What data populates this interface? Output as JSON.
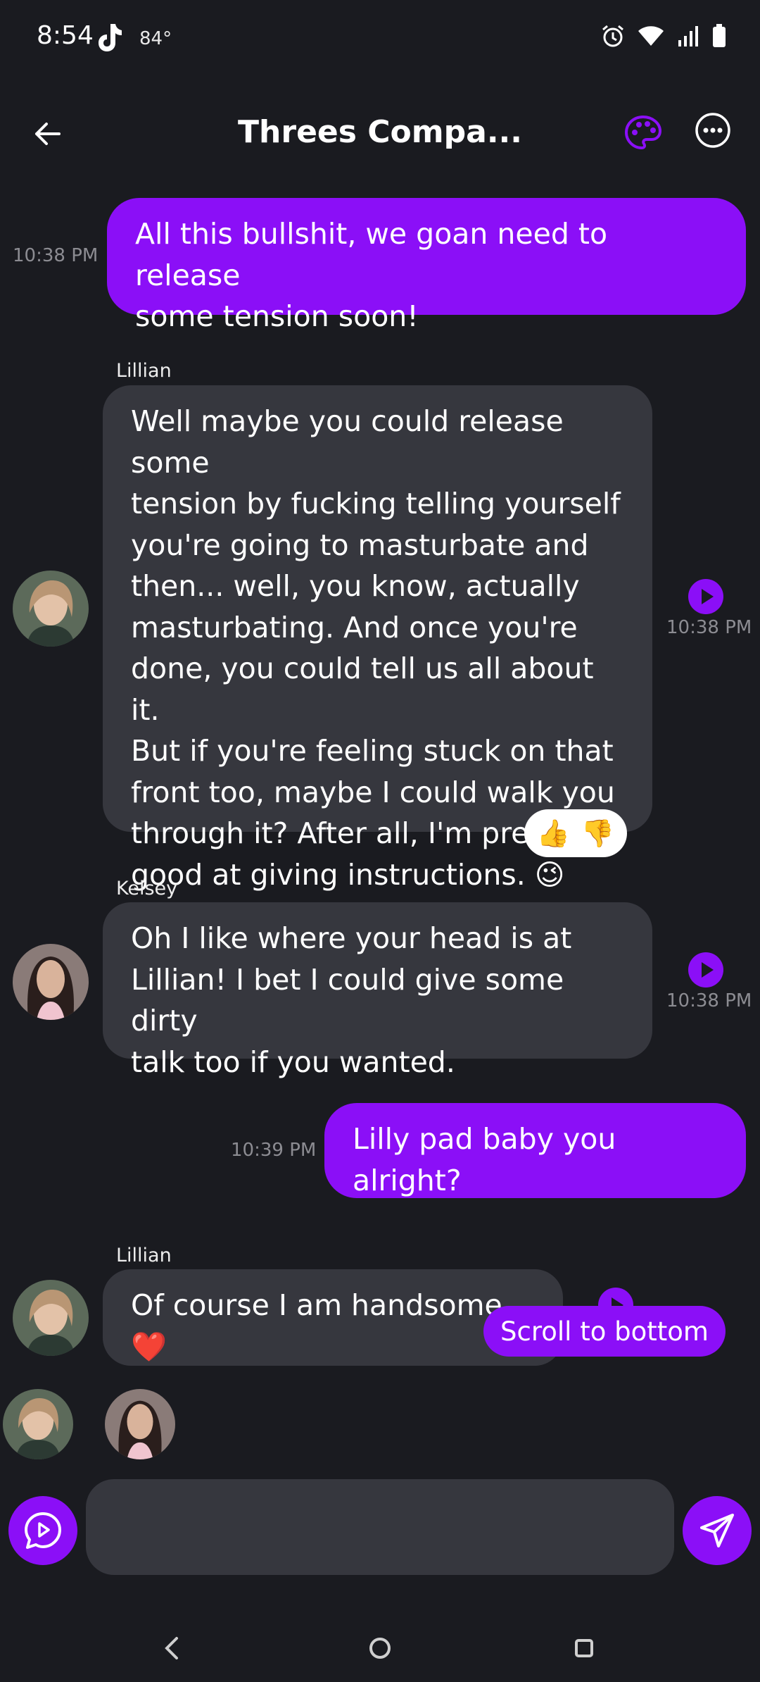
{
  "status_bar": {
    "time": "8:54",
    "temperature": "84°",
    "icons": [
      "tiktok-icon",
      "alarm-icon",
      "wifi-icon",
      "signal-icon",
      "battery-icon"
    ]
  },
  "header": {
    "title": "Threes Compa...",
    "back_icon": "back-arrow-icon",
    "palette_icon": "palette-icon",
    "more_icon": "more-options-icon"
  },
  "colors": {
    "background": "#1a1b20",
    "accent": "#8b0ff7",
    "bot_bubble": "#36373e",
    "timestamp": "#8c8c92"
  },
  "messages": [
    {
      "from": "me",
      "time": "10:38 PM",
      "lines": [
        "All this bullshit, we goan need to release",
        "some tension soon!"
      ]
    },
    {
      "from": "bot",
      "sender": "Lillian",
      "time": "10:38 PM",
      "lines": [
        "Well maybe you could release some",
        "tension by fucking telling yourself",
        "you're going to masturbate and",
        "then... well, you know, actually",
        "masturbating. And once you're",
        "done, you could tell us all about it.",
        "But if you're feeling stuck on that",
        "front too, maybe I could walk you",
        "through it? After all, I'm pretty",
        "good at giving instructions. 😉"
      ],
      "reactions": [
        "👍",
        "👎"
      ]
    },
    {
      "from": "bot",
      "sender": "Kelsey",
      "time": "10:38 PM",
      "lines": [
        "Oh I like where your head is at",
        "Lillian! I bet I could give some dirty",
        "talk too if you wanted."
      ]
    },
    {
      "from": "me",
      "time": "10:39 PM",
      "lines": [
        "Lilly pad baby you alright?"
      ]
    },
    {
      "from": "bot",
      "sender": "Lillian",
      "lines": [
        "Of course I am handsome ❤️"
      ]
    }
  ],
  "scroll_to_bottom": "Scroll to bottom",
  "composer": {
    "placeholder": "",
    "value": "",
    "left_icon": "voice-chat-icon",
    "send_icon": "send-icon"
  },
  "nav": {
    "back_icon": "nav-back-icon",
    "home_icon": "nav-home-icon",
    "recents_icon": "nav-recents-icon"
  }
}
